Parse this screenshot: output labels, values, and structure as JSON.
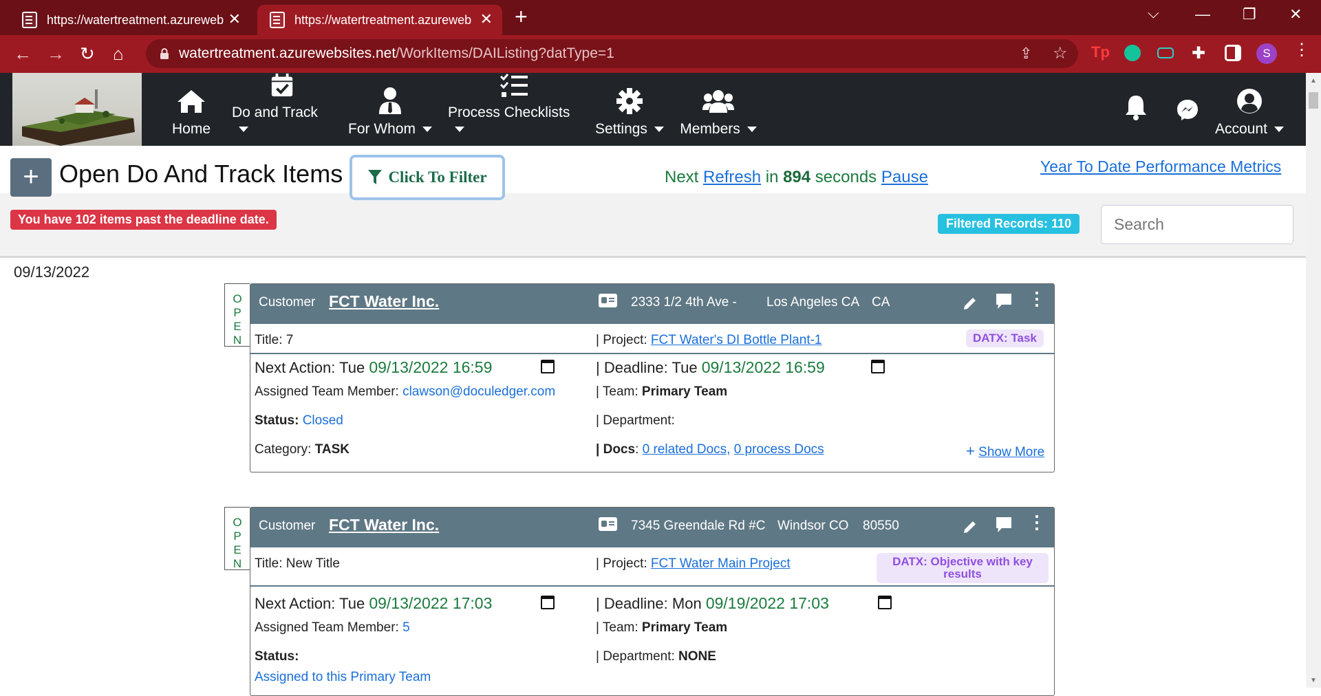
{
  "browser": {
    "tabs": [
      {
        "title": "https://watertreatment.azureweb"
      },
      {
        "title": "https://watertreatment.azureweb"
      }
    ],
    "url_host": "watertreatment.azurewebsites.net",
    "url_path": "/WorkItems/DAIListing?datType=1",
    "profile_initial": "S"
  },
  "nav": {
    "items": [
      {
        "label": "Home",
        "icon": "home-icon"
      },
      {
        "label": "Do and Track",
        "icon": "calendar-check-icon"
      },
      {
        "label": "For Whom",
        "icon": "user-tie-icon"
      },
      {
        "label": "Process Checklists",
        "icon": "checklist-icon"
      },
      {
        "label": "Settings",
        "icon": "gear-icon"
      },
      {
        "label": "Members",
        "icon": "users-icon"
      }
    ],
    "account_label": "Account"
  },
  "header": {
    "add_label": "+",
    "title": "Open Do And Track Items",
    "filter_label": "Click To Filter",
    "refresh_prefix": "Next ",
    "refresh_link": "Refresh",
    "refresh_in": " in ",
    "refresh_seconds": "894",
    "refresh_suffix": " seconds ",
    "pause_link": "Pause",
    "ytd_link": "Year To Date Performance Metrics",
    "past_due_badge": "You have 102 items past the deadline date.",
    "filtered_badge": "Filtered Records: 110",
    "search_placeholder": "Search"
  },
  "group_date": "09/13/2022",
  "cards": [
    {
      "status_tab": [
        "O",
        "P",
        "E",
        "N"
      ],
      "customer_label": "Customer",
      "customer": "FCT Water Inc.",
      "address": "2333 1/2 4th Ave -",
      "city": "Los Angeles CA",
      "zip": "CA",
      "title_label": "Title: ",
      "title": "7",
      "project_label": "| Project: ",
      "project": "FCT Water's DI Bottle Plant-1",
      "datx": "DATX: Task",
      "next_action_label": "Next Action: Tue ",
      "next_action": "09/13/2022 16:59",
      "deadline_label": "| Deadline: Tue ",
      "deadline": "09/13/2022 16:59",
      "assigned_label": "Assigned Team Member: ",
      "assigned": "clawson@doculedger.com",
      "team_label": "| Team: ",
      "team": "Primary Team",
      "status_label": "Status:",
      "status": "Closed",
      "department_label": "| Department:",
      "department": "",
      "category_label": "Category: ",
      "category": "TASK",
      "docs_label": "| Docs",
      "docs_related": "0 related Docs,",
      "docs_process": "0 process Docs",
      "show_more": "Show More"
    },
    {
      "status_tab": [
        "O",
        "P",
        "E",
        "N"
      ],
      "customer_label": "Customer",
      "customer": "FCT Water Inc.",
      "address": "7345 Greendale Rd #C",
      "city": "Windsor CO",
      "zip": "80550",
      "title_label": "Title: ",
      "title": "New Title",
      "project_label": "| Project: ",
      "project": "FCT Water Main Project",
      "datx": "DATX: Objective with key results",
      "next_action_label": "Next Action: Tue ",
      "next_action": "09/13/2022 17:03",
      "deadline_label": "| Deadline: Mon ",
      "deadline": "09/19/2022 17:03",
      "assigned_label": "Assigned Team Member: ",
      "assigned": "5",
      "team_label": "| Team: ",
      "team": "Primary Team",
      "status_label": "Status:",
      "status": "Assigned to this Primary Team",
      "department_label": "| Department: ",
      "department": "NONE"
    }
  ],
  "colors": {
    "tab_strip": "#6b1016",
    "toolbar": "#9e1a22",
    "navbar": "#212529",
    "card_header": "#5f7885",
    "accent_green": "#1b7a3e",
    "link": "#1a6fd9",
    "danger": "#dc3545",
    "info": "#27c0e0"
  }
}
